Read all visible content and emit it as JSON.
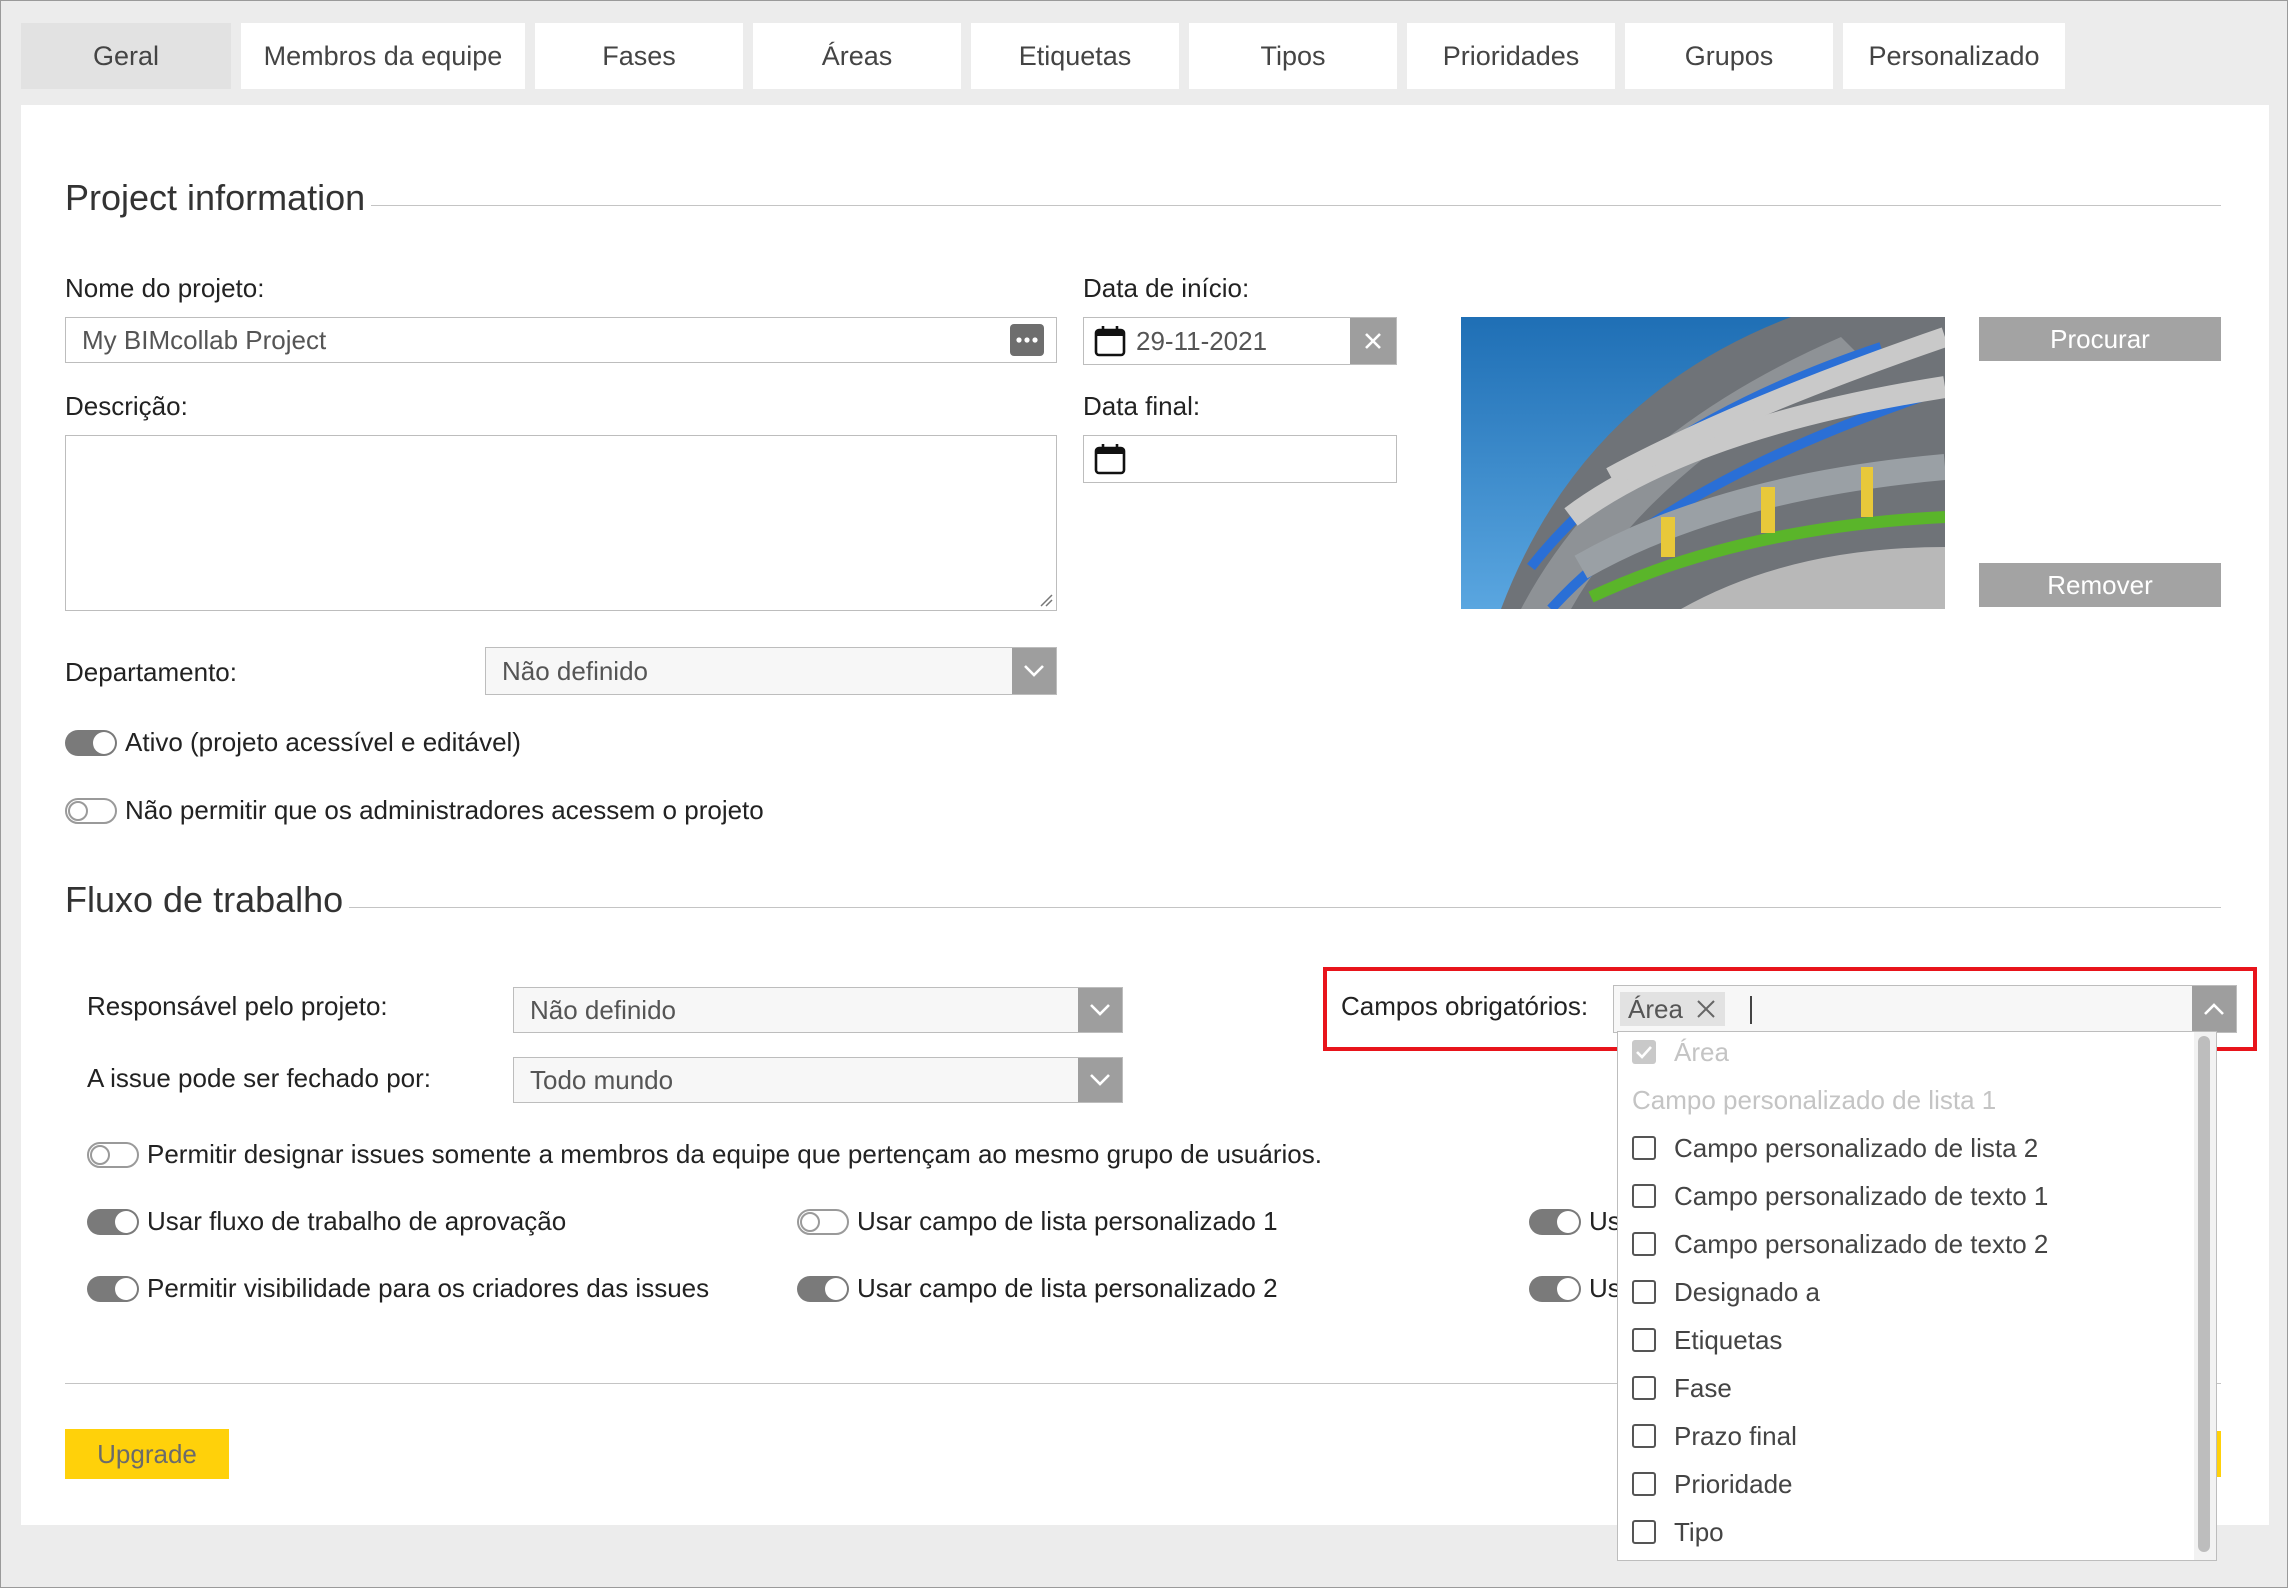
{
  "tabs": [
    {
      "label": "Geral",
      "active": true
    },
    {
      "label": "Membros da equipe"
    },
    {
      "label": "Fases"
    },
    {
      "label": "Áreas"
    },
    {
      "label": "Etiquetas"
    },
    {
      "label": "Tipos"
    },
    {
      "label": "Prioridades"
    },
    {
      "label": "Grupos"
    },
    {
      "label": "Personalizado"
    }
  ],
  "project_info": {
    "title": "Project information",
    "name_label": "Nome do projeto:",
    "name_value": "My BIMcollab Project",
    "description_label": "Descrição:",
    "start_label": "Data de início:",
    "start_value": "29-11-2021",
    "end_label": "Data final:",
    "end_value": "",
    "browse_button": "Procurar",
    "remove_button": "Remover",
    "department_label": "Departamento:",
    "department_value": "Não definido",
    "active_toggle_label": "Ativo (projeto acessível e editável)",
    "no_admin_toggle_label": "Não permitir que os administradores acessem o projeto"
  },
  "workflow": {
    "title": "Fluxo de trabalho",
    "responsible_label": "Responsável pelo projeto:",
    "responsible_value": "Não definido",
    "closable_label": "A issue pode ser fechado por:",
    "closable_value": "Todo mundo",
    "required_label": "Campos obrigatórios:",
    "required_tag": "Área",
    "toggles": {
      "assign_group": "Permitir designar issues somente a membros da equipe que pertençam ao mesmo grupo de usuários.",
      "approval": "Usar fluxo de trabalho de aprovação",
      "visibility": "Permitir visibilidade para os criadores das issues",
      "custom_list_1": "Usar campo de lista personalizado 1",
      "custom_list_2": "Usar campo de lista personalizado 2",
      "clipped_1": "Us",
      "clipped_2": "Us"
    },
    "upgrade_button": "Upgrade"
  },
  "dropdown": {
    "items": [
      "Área",
      "Campo personalizado de lista 1",
      "Campo personalizado de lista 2",
      "Campo personalizado de texto 1",
      "Campo personalizado de texto 2",
      "Designado a",
      "Etiquetas",
      "Fase",
      "Prazo final",
      "Prioridade",
      "Tipo"
    ]
  },
  "colors": {
    "accent_yellow": "#ffd10a",
    "highlight_red": "#e8141b",
    "button_grey": "#a3a3a3"
  },
  "icons": [
    "calendar-icon",
    "clear-x-icon",
    "more-dots-icon",
    "chevron-down-icon",
    "chevron-up-icon",
    "tag-remove-x-icon",
    "checkbox-icon"
  ]
}
